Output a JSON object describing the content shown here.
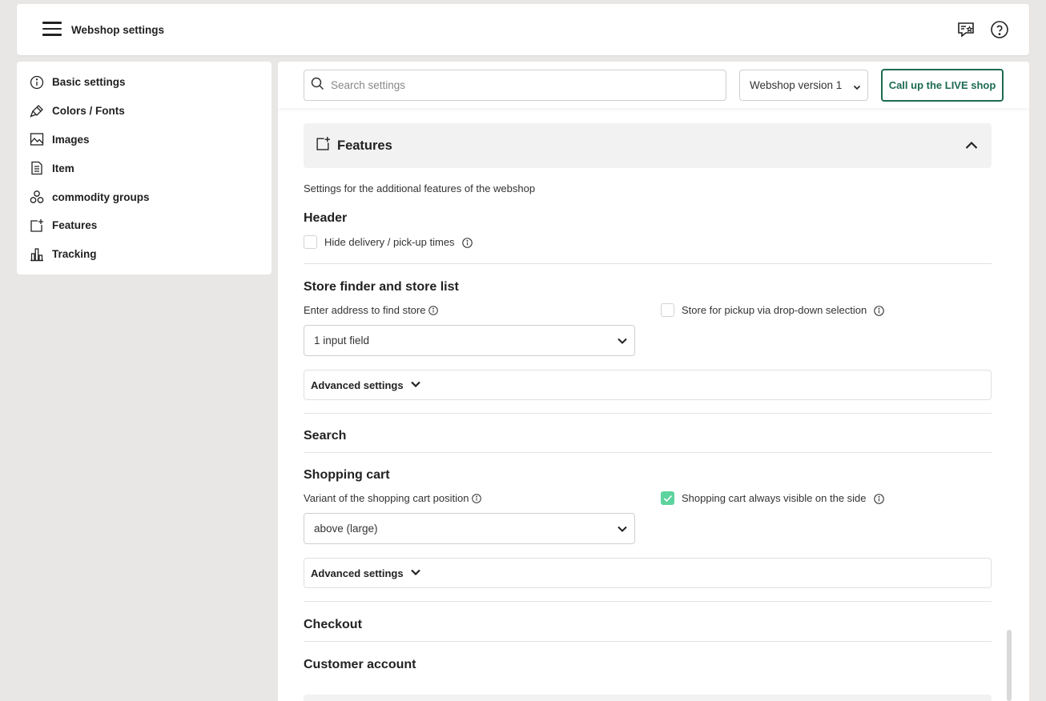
{
  "header": {
    "title": "Webshop settings",
    "chat_icon": "chat-star-icon",
    "help_icon": "help-circle-icon"
  },
  "sidebar": {
    "items": [
      {
        "label": "Basic settings",
        "icon": "info-circle-icon"
      },
      {
        "label": "Colors / Fonts",
        "icon": "paint-brush-icon"
      },
      {
        "label": "Images",
        "icon": "image-icon"
      },
      {
        "label": "Item",
        "icon": "document-list-icon"
      },
      {
        "label": "commodity groups",
        "icon": "circles-icon"
      },
      {
        "label": "Features",
        "icon": "add-square-icon"
      },
      {
        "label": "Tracking",
        "icon": "bar-chart-icon"
      }
    ]
  },
  "toolbar": {
    "search_placeholder": "Search settings",
    "version_value": "Webshop version 1",
    "live_button": "Call up the LIVE shop"
  },
  "features": {
    "title": "Features",
    "description": "Settings for the additional features of the webshop",
    "header_section": {
      "title": "Header",
      "hide_times_label": "Hide delivery / pick-up times",
      "hide_times_checked": false
    },
    "store_finder": {
      "title": "Store finder and store list",
      "address_label": "Enter address to find store",
      "address_value": "1 input field",
      "pickup_label": "Store for pickup via drop-down selection",
      "pickup_checked": false,
      "advanced_label": "Advanced settings"
    },
    "search": {
      "title": "Search"
    },
    "shopping_cart": {
      "title": "Shopping cart",
      "variant_label": "Variant of the shopping cart position",
      "variant_value": "above (large)",
      "visible_label": "Shopping cart always visible on the side",
      "visible_checked": true,
      "advanced_label": "Advanced settings"
    },
    "checkout": {
      "title": "Checkout"
    },
    "customer_account": {
      "title": "Customer account"
    }
  },
  "colors": {
    "accent": "#1c6b53",
    "check": "#5dd39e"
  }
}
